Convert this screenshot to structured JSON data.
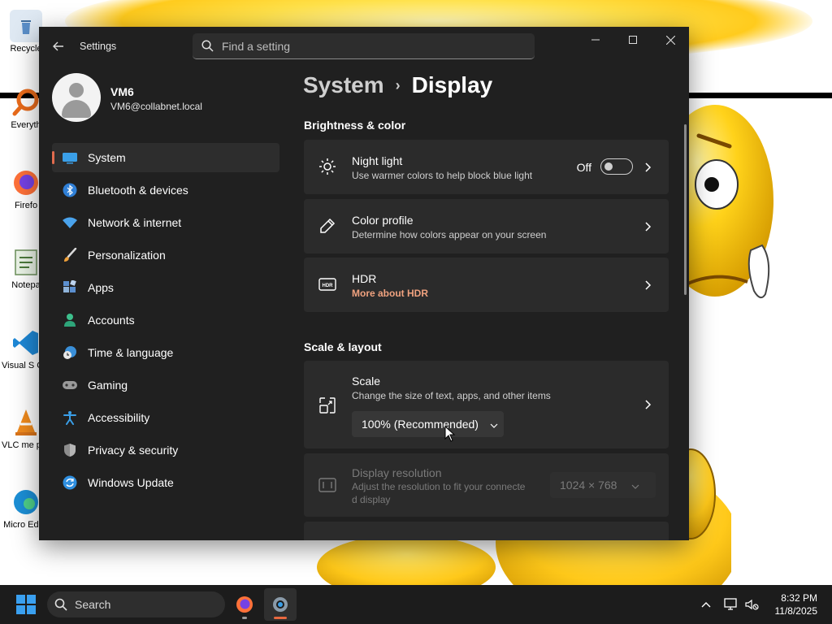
{
  "desktop": {
    "icons": [
      {
        "label": "Recycle",
        "name": "recycle-bin-icon"
      },
      {
        "label": "Everyth",
        "name": "everything-icon"
      },
      {
        "label": "Firefo",
        "name": "firefox-icon"
      },
      {
        "label": "Notepa",
        "name": "notepad-icon"
      },
      {
        "label": "Visual S Cod",
        "name": "vscode-icon"
      },
      {
        "label": "VLC me playe",
        "name": "vlc-icon"
      },
      {
        "label": "Micro Edge",
        "name": "edge-icon"
      }
    ]
  },
  "window": {
    "app_title": "Settings",
    "search_placeholder": "Find a setting",
    "controls": {
      "minimize": "—",
      "maximize": "☐",
      "close": "✕"
    }
  },
  "profile": {
    "name": "VM6",
    "email": "VM6@collabnet.local"
  },
  "sidebar": {
    "items": [
      {
        "label": "System",
        "icon": "system-icon",
        "active": true
      },
      {
        "label": "Bluetooth & devices",
        "icon": "bluetooth-icon"
      },
      {
        "label": "Network & internet",
        "icon": "wifi-icon"
      },
      {
        "label": "Personalization",
        "icon": "brush-icon"
      },
      {
        "label": "Apps",
        "icon": "apps-icon"
      },
      {
        "label": "Accounts",
        "icon": "accounts-icon"
      },
      {
        "label": "Time & language",
        "icon": "globe-clock-icon"
      },
      {
        "label": "Gaming",
        "icon": "gamepad-icon"
      },
      {
        "label": "Accessibility",
        "icon": "accessibility-icon"
      },
      {
        "label": "Privacy & security",
        "icon": "shield-icon"
      },
      {
        "label": "Windows Update",
        "icon": "update-icon"
      }
    ]
  },
  "breadcrumb": {
    "parent": "System",
    "separator": "›",
    "current": "Display"
  },
  "sections": {
    "brightness": "Brightness & color",
    "scale_layout": "Scale & layout"
  },
  "cards": {
    "night_light": {
      "title": "Night light",
      "subtitle": "Use warmer colors to help block blue light",
      "toggle_label": "Off",
      "toggle_on": false
    },
    "color_profile": {
      "title": "Color profile",
      "subtitle": "Determine how colors appear on your screen"
    },
    "hdr": {
      "title": "HDR",
      "link": "More about HDR",
      "link_color": "#f0a27f",
      "icon_text": "HDR"
    },
    "scale": {
      "title": "Scale",
      "subtitle": "Change the size of text, apps, and other items",
      "value": "100% (Recommended)"
    },
    "display_resolution": {
      "title": "Display resolution",
      "subtitle_line1": "Adjust the resolution to fit your connecte",
      "subtitle_line2": "d display",
      "value": "1024 × 768",
      "disabled": true
    }
  },
  "taskbar": {
    "search_label": "Search",
    "apps": [
      {
        "name": "firefox",
        "active": false
      },
      {
        "name": "settings",
        "active": true
      }
    ],
    "time": "8:32 PM",
    "date": "11/8/2025"
  },
  "colors": {
    "accent": "#e16b4e",
    "window_bg": "#202020",
    "card_bg": "#2b2b2b",
    "taskbar_bg": "#1c1c1c"
  }
}
